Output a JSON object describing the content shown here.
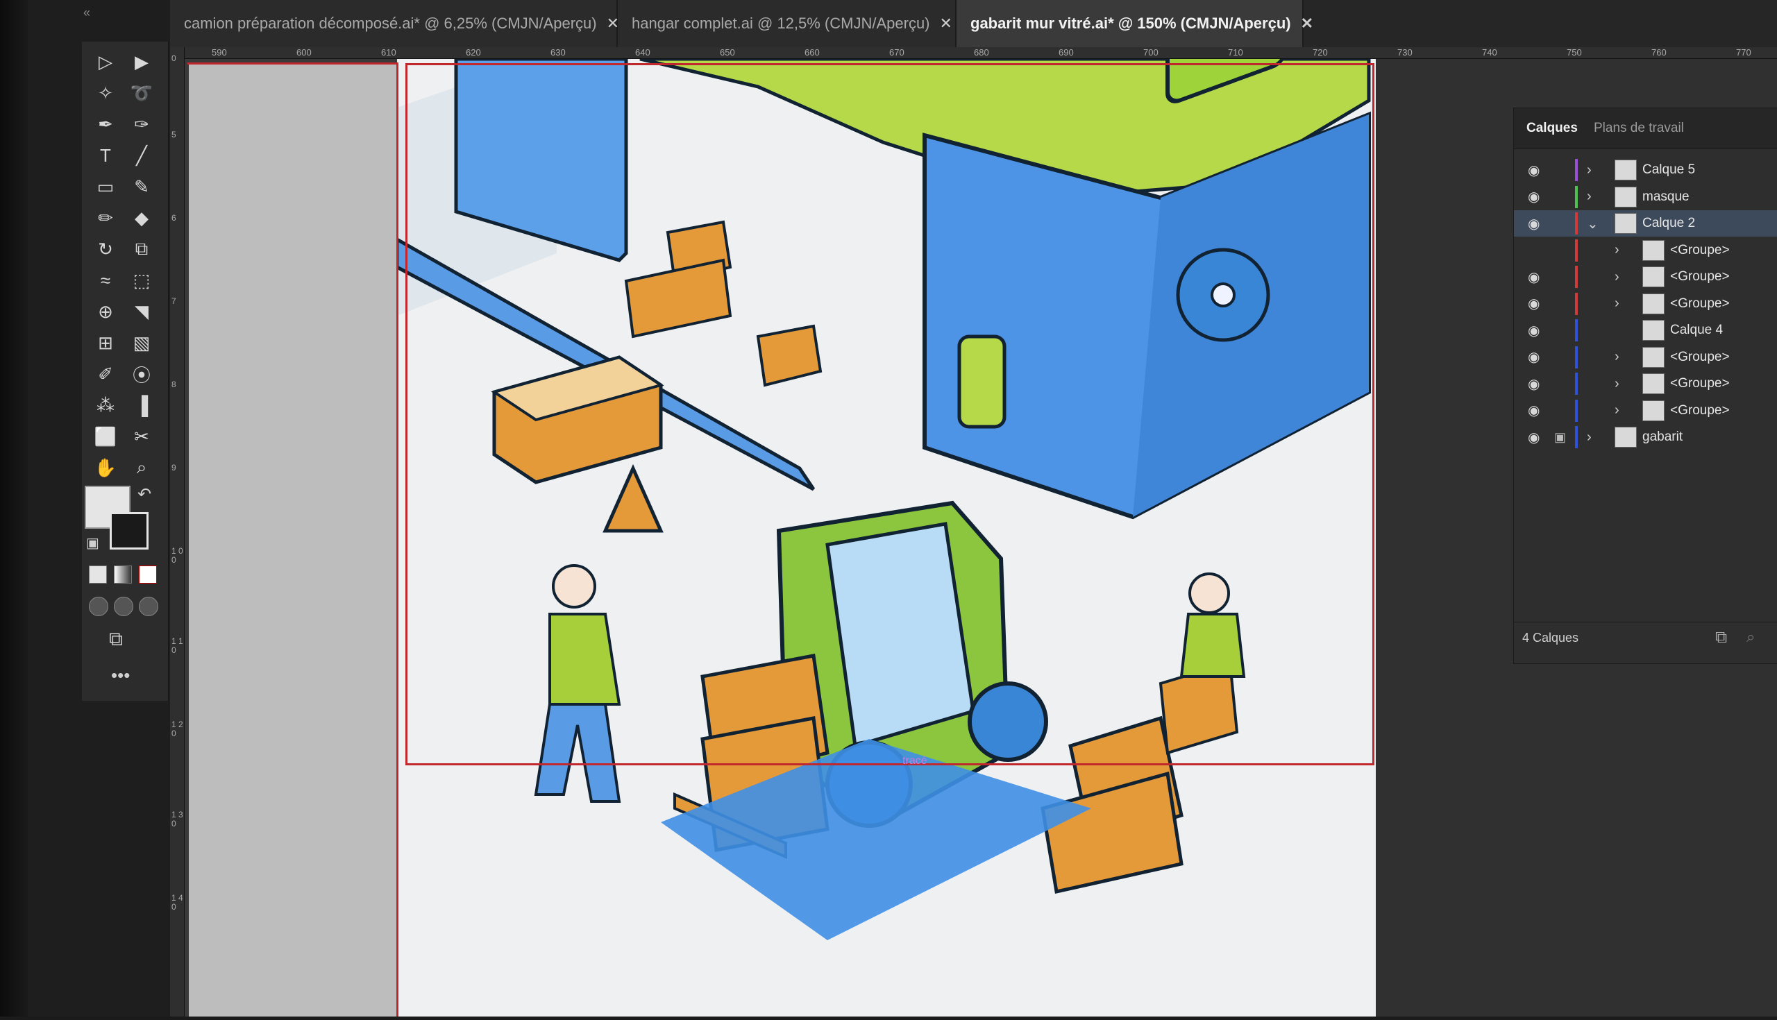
{
  "toolbar": {
    "grip": "«",
    "more": "•••"
  },
  "tabs": [
    {
      "label": "camion préparation décomposé.ai* @ 6,25% (CMJN/Aperçu)",
      "active": false
    },
    {
      "label": "hangar complet.ai @ 12,5% (CMJN/Aperçu)",
      "active": false
    },
    {
      "label": "gabarit mur vitré.ai* @ 150% (CMJN/Aperçu)",
      "active": true
    }
  ],
  "ruler": {
    "horizontal": [
      "590",
      "600",
      "610",
      "620",
      "630",
      "640",
      "650",
      "660",
      "670",
      "680",
      "690",
      "700",
      "710",
      "720",
      "730",
      "740",
      "750",
      "760",
      "770"
    ],
    "vertical": [
      "0",
      "5",
      "6",
      "7",
      "8",
      "9",
      "1 0 0",
      "1 1 0",
      "1 2 0",
      "1 3 0",
      "1 4 0"
    ]
  },
  "layers_panel": {
    "tabs": [
      "Calques",
      "Plans de travail"
    ],
    "layers": [
      {
        "name": "Calque 5",
        "color": "#9b4fd6",
        "expanded": false,
        "indent": 0,
        "visible": true
      },
      {
        "name": "masque",
        "color": "#4fbf4f",
        "expanded": false,
        "indent": 0,
        "visible": true
      },
      {
        "name": "Calque 2",
        "color": "#d23a3a",
        "expanded": true,
        "indent": 0,
        "visible": true,
        "selected": true
      },
      {
        "name": "<Groupe>",
        "color": "#d23a3a",
        "expanded": false,
        "indent": 1,
        "visible": false
      },
      {
        "name": "<Groupe>",
        "color": "#d23a3a",
        "expanded": false,
        "indent": 1,
        "visible": true
      },
      {
        "name": "<Groupe>",
        "color": "#d23a3a",
        "expanded": false,
        "indent": 1,
        "visible": true
      },
      {
        "name": "Calque 4",
        "color": "#2f52d8",
        "expanded": false,
        "indent": 1,
        "visible": true,
        "leaf": true
      },
      {
        "name": "<Groupe>",
        "color": "#2f52d8",
        "expanded": false,
        "indent": 1,
        "visible": true
      },
      {
        "name": "<Groupe>",
        "color": "#2f52d8",
        "expanded": false,
        "indent": 1,
        "visible": true
      },
      {
        "name": "<Groupe>",
        "color": "#2f52d8",
        "expanded": false,
        "indent": 1,
        "visible": true
      },
      {
        "name": "gabarit",
        "color": "#2f52d8",
        "expanded": false,
        "indent": 0,
        "visible": true,
        "locked": true
      }
    ],
    "footer_count": "4 Calques"
  },
  "canvas": {
    "cursor_label": "tracé"
  },
  "colors": {
    "artboard_guide": "#c0282e",
    "accent_blue": "#4a90e8",
    "accent_green": "#a6cf3a",
    "box_orange": "#e59a3a"
  }
}
